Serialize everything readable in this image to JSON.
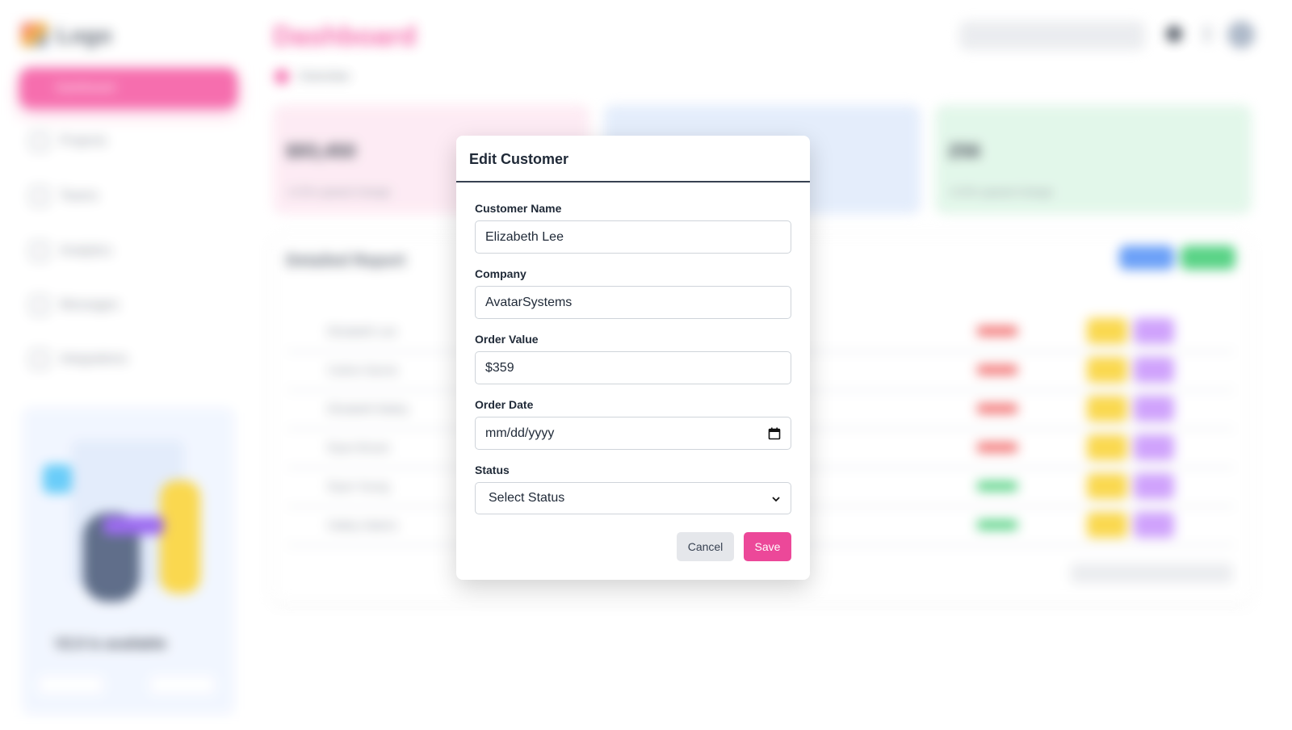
{
  "background": {
    "logo_text": "Logo",
    "page_title": "Dashboard",
    "breadcrumb": "Overview",
    "sidebar": {
      "items": [
        {
          "label": "Dashboard",
          "icon": "grid-icon",
          "active": true
        },
        {
          "label": "Projects",
          "icon": "folder-icon"
        },
        {
          "label": "Teams",
          "icon": "users-icon"
        },
        {
          "label": "Analytics",
          "icon": "chart-icon"
        },
        {
          "label": "Messages",
          "icon": "message-icon"
        },
        {
          "label": "Integrations",
          "icon": "plug-icon"
        }
      ],
      "promo_text": "V2.0 is available"
    },
    "cards": [
      {
        "value": "$93,450",
        "sub": "+2.5% upward change",
        "color": "#fde6f1"
      },
      {
        "value": "",
        "sub": "",
        "color": "#dce8fb"
      },
      {
        "value": "256",
        "sub": "+3.5% upward change",
        "color": "#daf5e4"
      }
    ],
    "table": {
      "title": "Detailed Report",
      "rows": [
        {
          "name": "Elizabeth Lee",
          "status_color": "#ef4444"
        },
        {
          "name": "Carlos Garcia",
          "status_color": "#ef4444"
        },
        {
          "name": "Elizabeth Bailey",
          "status_color": "#ef4444"
        },
        {
          "name": "Ryan Brown",
          "status_color": "#ef4444"
        },
        {
          "name": "Ryan Young",
          "status_color": "#22c55e"
        },
        {
          "name": "Hailey Adams",
          "status_color": "#22c55e"
        }
      ]
    }
  },
  "modal": {
    "title": "Edit Customer",
    "fields": {
      "customer_name": {
        "label": "Customer Name",
        "value": "Elizabeth Lee"
      },
      "company": {
        "label": "Company",
        "value": "AvatarSystems"
      },
      "order_value": {
        "label": "Order Value",
        "value": "$359"
      },
      "order_date": {
        "label": "Order Date",
        "placeholder": "mm/dd/yyyy"
      },
      "status": {
        "label": "Status",
        "selected": "Select Status"
      }
    },
    "buttons": {
      "cancel": "Cancel",
      "save": "Save"
    },
    "colors": {
      "save": "#ec4899",
      "cancel": "#e5e7eb"
    }
  }
}
